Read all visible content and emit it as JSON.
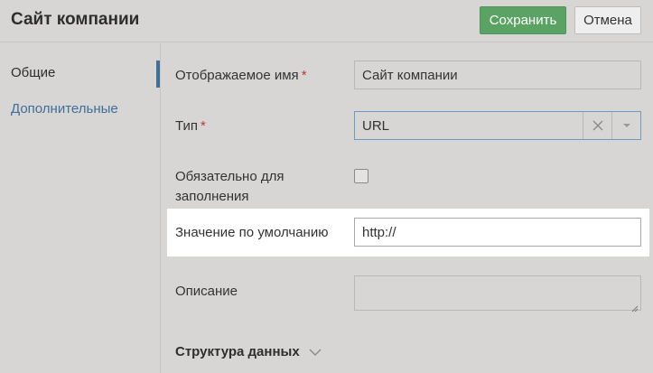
{
  "header": {
    "title": "Сайт компании",
    "save_label": "Сохранить",
    "cancel_label": "Отмена"
  },
  "sidebar": {
    "items": [
      {
        "label": "Общие",
        "active": true
      },
      {
        "label": "Дополнительные",
        "active": false
      }
    ]
  },
  "form": {
    "display_name": {
      "label": "Отображаемое имя",
      "required_mark": "*",
      "value": "Сайт компании"
    },
    "type": {
      "label": "Тип",
      "required_mark": "*",
      "value": "URL"
    },
    "required": {
      "label_line1": "Обязательно для",
      "label_line2": "заполнения",
      "checked": false
    },
    "default_value": {
      "label": "Значение по умолчанию",
      "value": "http://"
    },
    "description": {
      "label": "Описание",
      "value": ""
    },
    "data_structure": {
      "label": "Структура данных"
    }
  },
  "icons": {
    "clear": "close-icon",
    "dropdown": "caret-down-icon",
    "section_toggle": "chevron-down-icon"
  },
  "colors": {
    "accent": "#3f6f9a",
    "save_button": "#5aa364",
    "required": "#c0392b",
    "background": "#d7d6d5"
  }
}
